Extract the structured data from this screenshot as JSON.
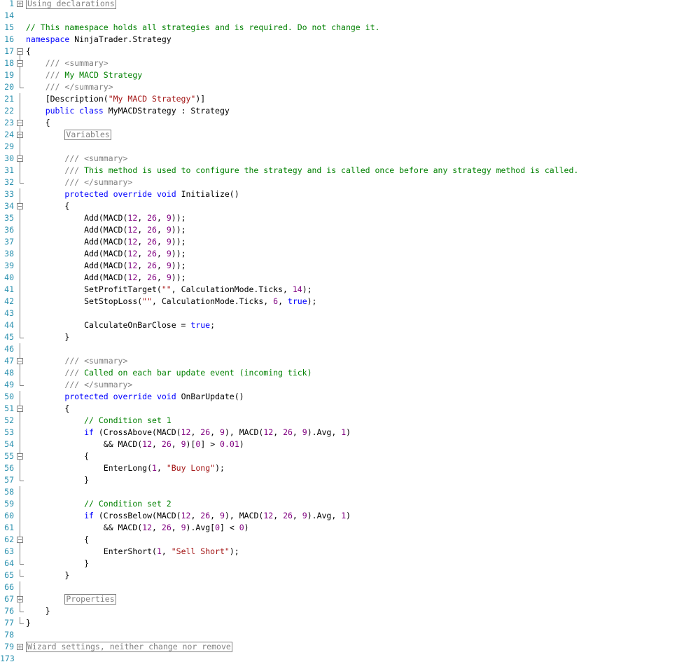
{
  "editor": {
    "lines": [
      {
        "n": "1",
        "fold": "plus",
        "spans": [
          {
            "c": "collapsed",
            "t": "Using declarations"
          }
        ]
      },
      {
        "n": "14",
        "spans": []
      },
      {
        "n": "15",
        "spans": [
          {
            "c": "cm",
            "t": "// This namespace holds all strategies and is required. Do not change it."
          }
        ]
      },
      {
        "n": "16",
        "spans": [
          {
            "c": "kw",
            "t": "namespace"
          },
          {
            "t": " NinjaTrader.Strategy"
          }
        ]
      },
      {
        "n": "17",
        "fold": "minus",
        "spans": [
          {
            "t": "{"
          }
        ]
      },
      {
        "n": "18",
        "fold": "minus",
        "spans": [
          {
            "t": "    "
          },
          {
            "c": "doc",
            "t": "/// <summary>"
          }
        ]
      },
      {
        "n": "19",
        "spans": [
          {
            "t": "    "
          },
          {
            "c": "doc",
            "t": "///"
          },
          {
            "c": "cm",
            "t": " My MACD Strategy"
          }
        ]
      },
      {
        "n": "20",
        "fold": "end",
        "spans": [
          {
            "t": "    "
          },
          {
            "c": "doc",
            "t": "/// </summary>"
          }
        ]
      },
      {
        "n": "21",
        "spans": [
          {
            "t": "    [Description("
          },
          {
            "c": "str",
            "t": "\"My MACD Strategy\""
          },
          {
            "t": ")]"
          }
        ]
      },
      {
        "n": "22",
        "spans": [
          {
            "t": "    "
          },
          {
            "c": "kw",
            "t": "public class"
          },
          {
            "t": " MyMACDStrategy : Strategy"
          }
        ]
      },
      {
        "n": "23",
        "fold": "minus",
        "spans": [
          {
            "t": "    {"
          }
        ]
      },
      {
        "n": "24",
        "fold": "plus",
        "spans": [
          {
            "t": "        "
          },
          {
            "c": "collapsed",
            "t": "Variables"
          }
        ]
      },
      {
        "n": "29",
        "spans": []
      },
      {
        "n": "30",
        "fold": "minus",
        "spans": [
          {
            "t": "        "
          },
          {
            "c": "doc",
            "t": "/// <summary>"
          }
        ]
      },
      {
        "n": "31",
        "spans": [
          {
            "t": "        "
          },
          {
            "c": "doc",
            "t": "///"
          },
          {
            "c": "cm",
            "t": " This method is used to configure the strategy and is called once before any strategy method is called."
          }
        ]
      },
      {
        "n": "32",
        "fold": "end",
        "spans": [
          {
            "t": "        "
          },
          {
            "c": "doc",
            "t": "/// </summary>"
          }
        ]
      },
      {
        "n": "33",
        "spans": [
          {
            "t": "        "
          },
          {
            "c": "kw",
            "t": "protected override void"
          },
          {
            "t": " Initialize()"
          }
        ]
      },
      {
        "n": "34",
        "fold": "minus",
        "spans": [
          {
            "t": "        {"
          }
        ]
      },
      {
        "n": "35",
        "spans": [
          {
            "t": "            Add(MACD("
          },
          {
            "c": "num",
            "t": "12"
          },
          {
            "t": ", "
          },
          {
            "c": "num",
            "t": "26"
          },
          {
            "t": ", "
          },
          {
            "c": "num",
            "t": "9"
          },
          {
            "t": "));"
          }
        ]
      },
      {
        "n": "36",
        "spans": [
          {
            "t": "            Add(MACD("
          },
          {
            "c": "num",
            "t": "12"
          },
          {
            "t": ", "
          },
          {
            "c": "num",
            "t": "26"
          },
          {
            "t": ", "
          },
          {
            "c": "num",
            "t": "9"
          },
          {
            "t": "));"
          }
        ]
      },
      {
        "n": "37",
        "spans": [
          {
            "t": "            Add(MACD("
          },
          {
            "c": "num",
            "t": "12"
          },
          {
            "t": ", "
          },
          {
            "c": "num",
            "t": "26"
          },
          {
            "t": ", "
          },
          {
            "c": "num",
            "t": "9"
          },
          {
            "t": "));"
          }
        ]
      },
      {
        "n": "38",
        "spans": [
          {
            "t": "            Add(MACD("
          },
          {
            "c": "num",
            "t": "12"
          },
          {
            "t": ", "
          },
          {
            "c": "num",
            "t": "26"
          },
          {
            "t": ", "
          },
          {
            "c": "num",
            "t": "9"
          },
          {
            "t": "));"
          }
        ]
      },
      {
        "n": "39",
        "spans": [
          {
            "t": "            Add(MACD("
          },
          {
            "c": "num",
            "t": "12"
          },
          {
            "t": ", "
          },
          {
            "c": "num",
            "t": "26"
          },
          {
            "t": ", "
          },
          {
            "c": "num",
            "t": "9"
          },
          {
            "t": "));"
          }
        ]
      },
      {
        "n": "40",
        "spans": [
          {
            "t": "            Add(MACD("
          },
          {
            "c": "num",
            "t": "12"
          },
          {
            "t": ", "
          },
          {
            "c": "num",
            "t": "26"
          },
          {
            "t": ", "
          },
          {
            "c": "num",
            "t": "9"
          },
          {
            "t": "));"
          }
        ]
      },
      {
        "n": "41",
        "spans": [
          {
            "t": "            SetProfitTarget("
          },
          {
            "c": "str",
            "t": "\"\""
          },
          {
            "t": ", CalculationMode.Ticks, "
          },
          {
            "c": "num",
            "t": "14"
          },
          {
            "t": ");"
          }
        ]
      },
      {
        "n": "42",
        "spans": [
          {
            "t": "            SetStopLoss("
          },
          {
            "c": "str",
            "t": "\"\""
          },
          {
            "t": ", CalculationMode.Ticks, "
          },
          {
            "c": "num",
            "t": "6"
          },
          {
            "t": ", "
          },
          {
            "c": "kw",
            "t": "true"
          },
          {
            "t": ");"
          }
        ]
      },
      {
        "n": "43",
        "spans": []
      },
      {
        "n": "44",
        "spans": [
          {
            "t": "            CalculateOnBarClose = "
          },
          {
            "c": "kw",
            "t": "true"
          },
          {
            "t": ";"
          }
        ]
      },
      {
        "n": "45",
        "fold": "end",
        "spans": [
          {
            "t": "        }"
          }
        ]
      },
      {
        "n": "46",
        "spans": []
      },
      {
        "n": "47",
        "fold": "minus",
        "spans": [
          {
            "t": "        "
          },
          {
            "c": "doc",
            "t": "/// <summary>"
          }
        ]
      },
      {
        "n": "48",
        "spans": [
          {
            "t": "        "
          },
          {
            "c": "doc",
            "t": "///"
          },
          {
            "c": "cm",
            "t": " Called on each bar update event (incoming tick)"
          }
        ]
      },
      {
        "n": "49",
        "fold": "end",
        "spans": [
          {
            "t": "        "
          },
          {
            "c": "doc",
            "t": "/// </summary>"
          }
        ]
      },
      {
        "n": "50",
        "spans": [
          {
            "t": "        "
          },
          {
            "c": "kw",
            "t": "protected override void"
          },
          {
            "t": " OnBarUpdate()"
          }
        ]
      },
      {
        "n": "51",
        "fold": "minus",
        "spans": [
          {
            "t": "        {"
          }
        ]
      },
      {
        "n": "52",
        "spans": [
          {
            "t": "            "
          },
          {
            "c": "cm",
            "t": "// Condition set 1"
          }
        ]
      },
      {
        "n": "53",
        "spans": [
          {
            "t": "            "
          },
          {
            "c": "kw",
            "t": "if"
          },
          {
            "t": " (CrossAbove(MACD("
          },
          {
            "c": "num",
            "t": "12"
          },
          {
            "t": ", "
          },
          {
            "c": "num",
            "t": "26"
          },
          {
            "t": ", "
          },
          {
            "c": "num",
            "t": "9"
          },
          {
            "t": "), MACD("
          },
          {
            "c": "num",
            "t": "12"
          },
          {
            "t": ", "
          },
          {
            "c": "num",
            "t": "26"
          },
          {
            "t": ", "
          },
          {
            "c": "num",
            "t": "9"
          },
          {
            "t": ").Avg, "
          },
          {
            "c": "num",
            "t": "1"
          },
          {
            "t": ")"
          }
        ]
      },
      {
        "n": "54",
        "spans": [
          {
            "t": "                && MACD("
          },
          {
            "c": "num",
            "t": "12"
          },
          {
            "t": ", "
          },
          {
            "c": "num",
            "t": "26"
          },
          {
            "t": ", "
          },
          {
            "c": "num",
            "t": "9"
          },
          {
            "t": ")["
          },
          {
            "c": "num",
            "t": "0"
          },
          {
            "t": "] > "
          },
          {
            "c": "num",
            "t": "0.01"
          },
          {
            "t": ")"
          }
        ]
      },
      {
        "n": "55",
        "fold": "minus",
        "spans": [
          {
            "t": "            {"
          }
        ]
      },
      {
        "n": "56",
        "spans": [
          {
            "t": "                EnterLong("
          },
          {
            "c": "num",
            "t": "1"
          },
          {
            "t": ", "
          },
          {
            "c": "str",
            "t": "\"Buy Long\""
          },
          {
            "t": ");"
          }
        ]
      },
      {
        "n": "57",
        "fold": "end",
        "spans": [
          {
            "t": "            }"
          }
        ]
      },
      {
        "n": "58",
        "spans": []
      },
      {
        "n": "59",
        "spans": [
          {
            "t": "            "
          },
          {
            "c": "cm",
            "t": "// Condition set 2"
          }
        ]
      },
      {
        "n": "60",
        "spans": [
          {
            "t": "            "
          },
          {
            "c": "kw",
            "t": "if"
          },
          {
            "t": " (CrossBelow(MACD("
          },
          {
            "c": "num",
            "t": "12"
          },
          {
            "t": ", "
          },
          {
            "c": "num",
            "t": "26"
          },
          {
            "t": ", "
          },
          {
            "c": "num",
            "t": "9"
          },
          {
            "t": "), MACD("
          },
          {
            "c": "num",
            "t": "12"
          },
          {
            "t": ", "
          },
          {
            "c": "num",
            "t": "26"
          },
          {
            "t": ", "
          },
          {
            "c": "num",
            "t": "9"
          },
          {
            "t": ").Avg, "
          },
          {
            "c": "num",
            "t": "1"
          },
          {
            "t": ")"
          }
        ]
      },
      {
        "n": "61",
        "spans": [
          {
            "t": "                && MACD("
          },
          {
            "c": "num",
            "t": "12"
          },
          {
            "t": ", "
          },
          {
            "c": "num",
            "t": "26"
          },
          {
            "t": ", "
          },
          {
            "c": "num",
            "t": "9"
          },
          {
            "t": ").Avg["
          },
          {
            "c": "num",
            "t": "0"
          },
          {
            "t": "] < "
          },
          {
            "c": "num",
            "t": "0"
          },
          {
            "t": ")"
          }
        ]
      },
      {
        "n": "62",
        "fold": "minus",
        "spans": [
          {
            "t": "            {"
          }
        ]
      },
      {
        "n": "63",
        "spans": [
          {
            "t": "                EnterShort("
          },
          {
            "c": "num",
            "t": "1"
          },
          {
            "t": ", "
          },
          {
            "c": "str",
            "t": "\"Sell Short\""
          },
          {
            "t": ");"
          }
        ]
      },
      {
        "n": "64",
        "fold": "end",
        "spans": [
          {
            "t": "            }"
          }
        ]
      },
      {
        "n": "65",
        "fold": "end",
        "spans": [
          {
            "t": "        }"
          }
        ]
      },
      {
        "n": "66",
        "spans": []
      },
      {
        "n": "67",
        "fold": "plus",
        "spans": [
          {
            "t": "        "
          },
          {
            "c": "collapsed",
            "t": "Properties"
          }
        ]
      },
      {
        "n": "76",
        "fold": "end",
        "spans": [
          {
            "t": "    }"
          }
        ]
      },
      {
        "n": "77",
        "fold": "end",
        "spans": [
          {
            "t": "}"
          }
        ]
      },
      {
        "n": "78",
        "spans": []
      },
      {
        "n": "79",
        "fold": "plus",
        "spans": [
          {
            "c": "collapsed",
            "t": "Wizard settings, neither change nor remove"
          }
        ]
      },
      {
        "n": "173",
        "spans": []
      }
    ]
  }
}
